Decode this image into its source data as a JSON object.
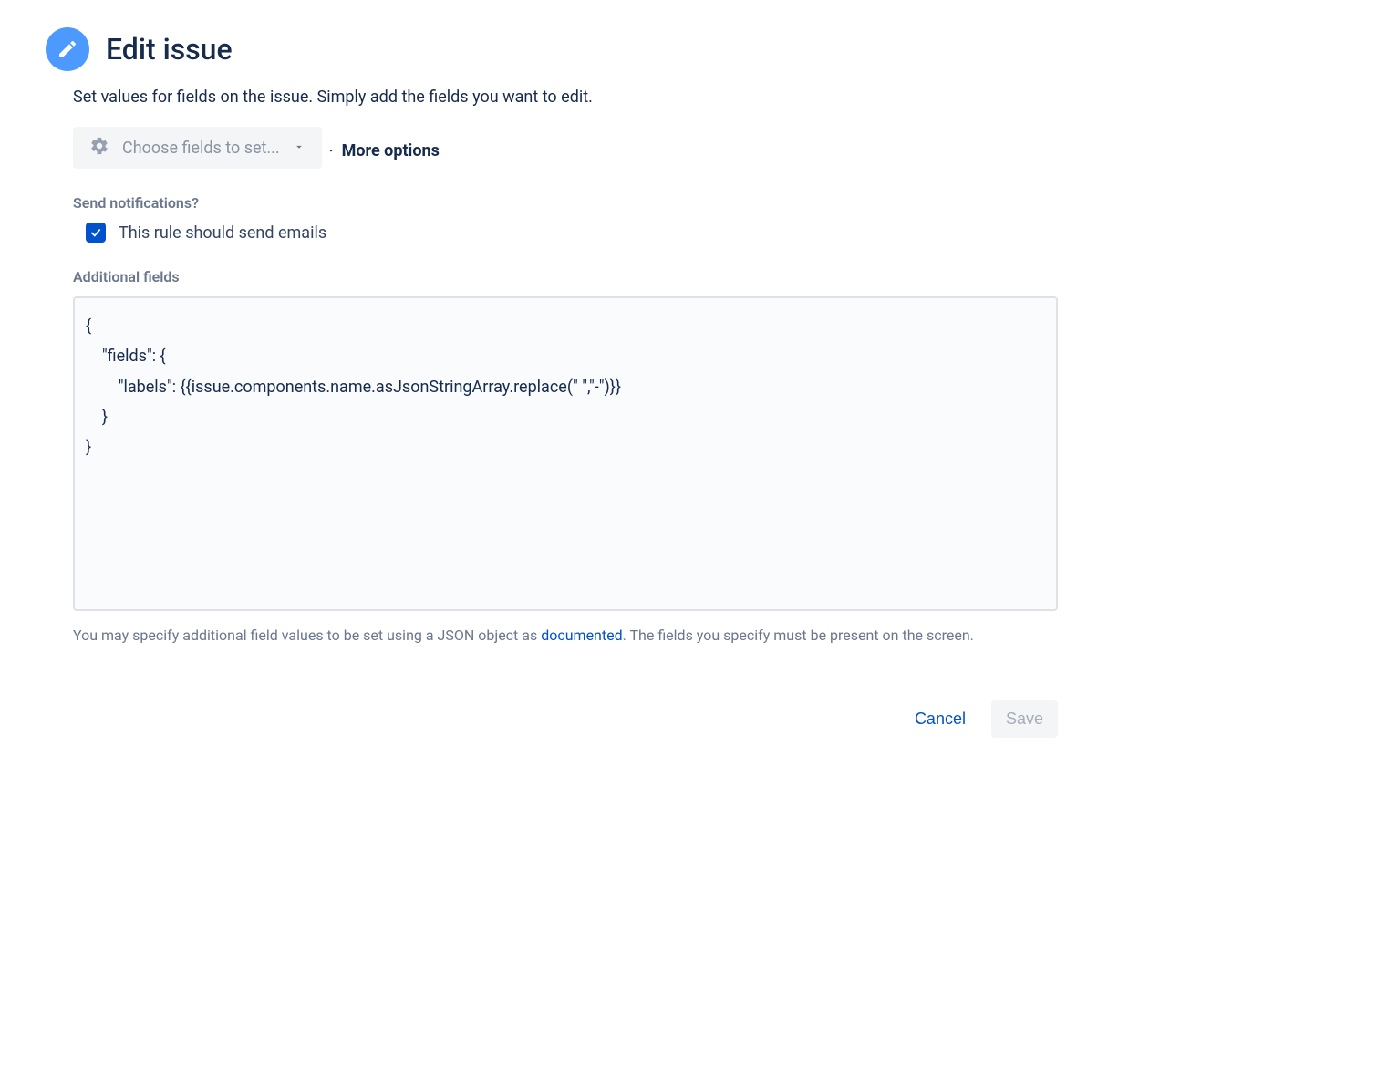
{
  "header": {
    "title": "Edit issue",
    "description": "Set values for fields on the issue. Simply add the fields you want to edit."
  },
  "fieldPicker": {
    "placeholder": "Choose fields to set..."
  },
  "moreOptions": {
    "label": "More options"
  },
  "notifications": {
    "label": "Send notifications?",
    "checkbox_label": "This rule should send emails",
    "checked": true
  },
  "additionalFields": {
    "label": "Additional fields",
    "value": "{\n    \"fields\": {\n        \"labels\": {{issue.components.name.asJsonStringArray.replace(\" \",\"-\")}}\n    }\n}",
    "help_prefix": "You may specify additional field values to be set using a JSON object as ",
    "help_link": "documented",
    "help_suffix": ". The fields you specify must be present on the screen."
  },
  "buttons": {
    "cancel": "Cancel",
    "save": "Save"
  }
}
